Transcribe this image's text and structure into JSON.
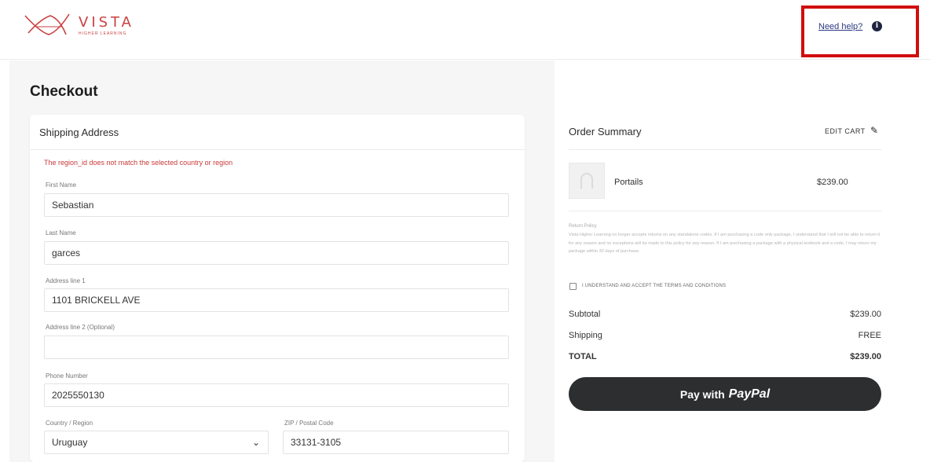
{
  "header": {
    "brand": "VISTA",
    "brand_sub": "HIGHER LEARNING",
    "help_link": "Need help?",
    "help_icon": "info-icon"
  },
  "checkout": {
    "title": "Checkout",
    "shipping": {
      "title": "Shipping Address",
      "error": "The region_id does not match the selected country or region",
      "first_name_label": "First Name",
      "first_name": "Sebastian",
      "last_name_label": "Last Name",
      "last_name": "garces",
      "address1_label": "Address line 1",
      "address1": "1101 BRICKELL AVE",
      "address2_label": "Address line 2 (Optional)",
      "address2": "",
      "phone_label": "Phone Number",
      "phone": "2025550130",
      "country_label": "Country / Region",
      "country": "Uruguay",
      "zip_label": "ZIP / Postal Code",
      "zip": "33131-3105"
    }
  },
  "summary": {
    "title": "Order Summary",
    "edit_cart": "EDIT CART",
    "item_name": "Portails",
    "item_price": "$239.00",
    "policy_title": "Return Policy",
    "policy_text": "Vista Higher Learning no longer accepts returns on any standalone codes. If I am purchasing a code only package, I understand that I will not be able to return it for any reason and no exceptions will be made to this policy for any reason. If I am purchasing a package with a physical textbook and a code, I may return my package within 30 days of purchase.",
    "terms_label": "I UNDERSTAND AND ACCEPT THE TERMS AND CONDITIONS",
    "subtotal_label": "Subtotal",
    "subtotal": "$239.00",
    "shipping_label": "Shipping",
    "shipping": "FREE",
    "total_label": "TOTAL",
    "total": "$239.00",
    "pay_prefix": "Pay with",
    "pay_brand": "PayPal"
  },
  "colors": {
    "brand": "#c94141",
    "error": "#c93a3a",
    "highlight_box": "#d10d0d",
    "paypal_button": "#2c2e2f"
  }
}
